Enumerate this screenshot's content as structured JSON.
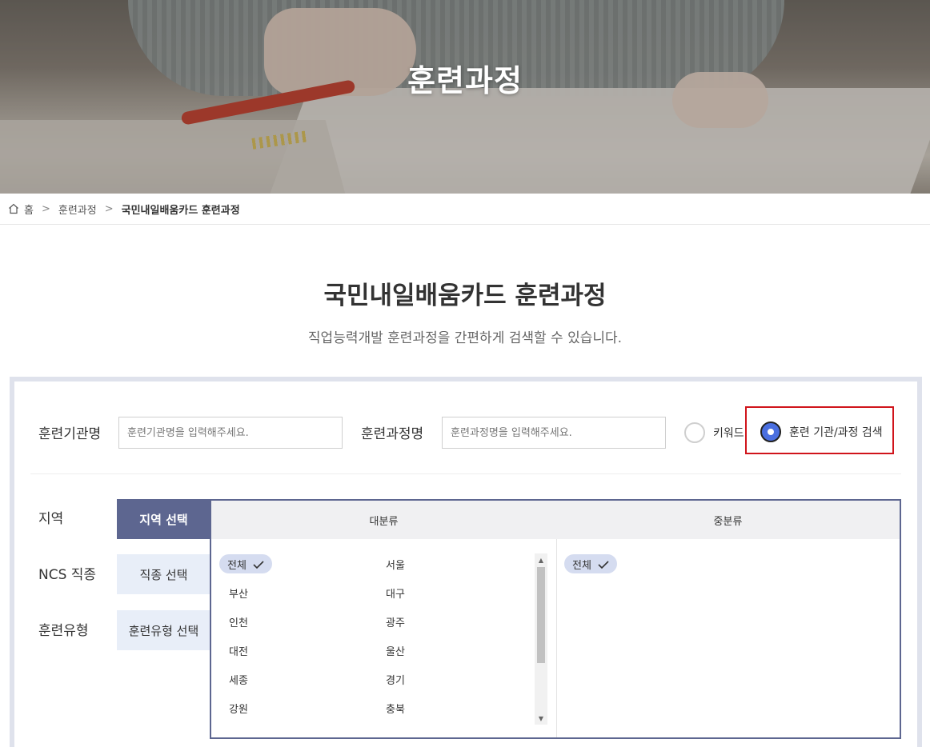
{
  "hero": {
    "title": "훈련과정"
  },
  "breadcrumb": {
    "home": "홈",
    "level1": "훈련과정",
    "current": "국민내일배움카드 훈련과정"
  },
  "page": {
    "title": "국민내일배움카드 훈련과정",
    "subtitle": "직업능력개발 훈련과정을 간편하게 검색할 수 있습니다."
  },
  "search": {
    "institution_label": "훈련기관명",
    "institution_placeholder": "훈련기관명을 입력해주세요.",
    "course_label": "훈련과정명",
    "course_placeholder": "훈련과정명을 입력해주세요.",
    "radio_keyword": "키워드",
    "radio_institution": "훈련 기관/과정 검색",
    "selected_mode": "훈련 기관/과정 검색"
  },
  "filters": {
    "region_label": "지역",
    "ncs_label": "NCS 직종",
    "type_label": "훈련유형",
    "region_button": "지역 선택",
    "ncs_button": "직종 선택",
    "type_button": "훈련유형 선택"
  },
  "picker": {
    "major_header": "대분류",
    "minor_header": "중분류",
    "major_items": [
      "전체",
      "서울",
      "부산",
      "대구",
      "인천",
      "광주",
      "대전",
      "울산",
      "세종",
      "경기",
      "강원",
      "충북"
    ],
    "major_selected": "전체",
    "minor_items": [
      "전체"
    ],
    "minor_selected": "전체"
  },
  "colors": {
    "accent": "#5d6690",
    "highlight": "#d0141b",
    "radio_active": "#4a6fe0",
    "chip": "#d5dcf0"
  }
}
